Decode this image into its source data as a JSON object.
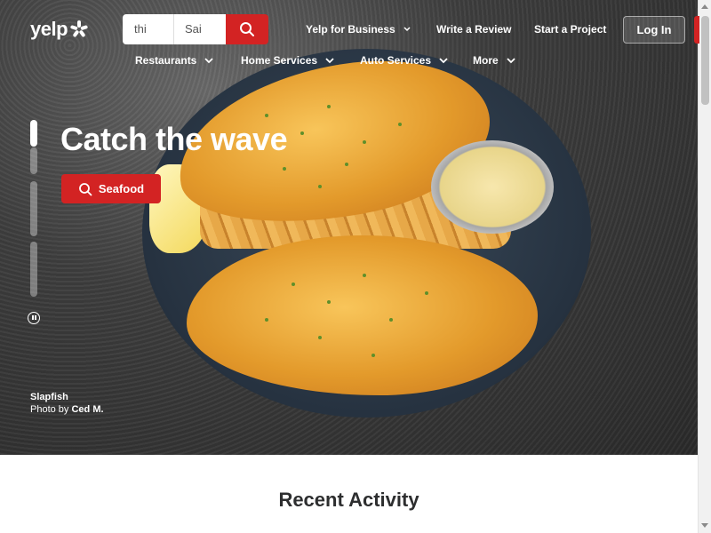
{
  "header": {
    "logo_text": "yelp",
    "search": {
      "find_value": "thi",
      "near_value": "Sai"
    },
    "links": {
      "business": "Yelp for Business",
      "review": "Write a Review",
      "project": "Start a Project"
    },
    "login_label": "Log In"
  },
  "categories": [
    "Restaurants",
    "Home Services",
    "Auto Services",
    "More"
  ],
  "hero": {
    "headline": "Catch the wave",
    "cta_label": "Seafood",
    "business_name": "Slapfish",
    "photo_prefix": "Photo by",
    "photographer": "Ced M."
  },
  "main": {
    "section_title": "Recent Activity"
  },
  "colors": {
    "brand_red": "#d32323"
  },
  "icons": [
    "yelp-burst-icon",
    "search-icon",
    "chevron-down-icon",
    "pause-icon"
  ]
}
